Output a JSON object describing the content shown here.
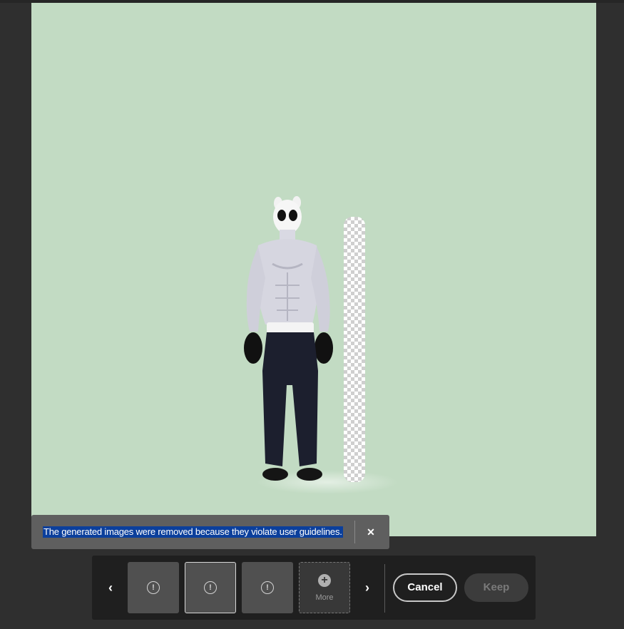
{
  "toast": {
    "message": "The generated images were removed because they violate user guidelines.",
    "close_icon": "close-icon"
  },
  "variations": {
    "prev_icon": "chevron-left-icon",
    "next_icon": "chevron-right-icon",
    "thumbnails": [
      {
        "icon": "warning-icon",
        "glyph": "!",
        "selected": false
      },
      {
        "icon": "warning-icon",
        "glyph": "!",
        "selected": true
      },
      {
        "icon": "warning-icon",
        "glyph": "!",
        "selected": false
      }
    ],
    "more_label": "More",
    "more_icon": "plus-circle-icon"
  },
  "actions": {
    "cancel_label": "Cancel",
    "keep_label": "Keep"
  },
  "colors": {
    "canvas_bg": "#c2dbc3",
    "app_bg": "#2f2f2f",
    "selection_highlight": "#0b3f9c"
  }
}
